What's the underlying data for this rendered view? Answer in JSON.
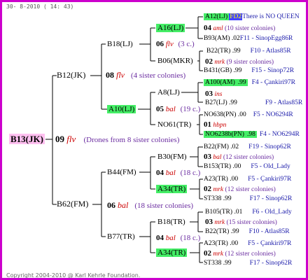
{
  "header": {
    "date": "30- 8-2010 ( 14: 43)"
  },
  "footer": {
    "copyright": "Copyright 2004-2010 @ Karl Kehrle Foundation."
  },
  "root": {
    "id": "B13(JK)",
    "year": "09",
    "mark": "flv",
    "note": "(Drones from 8 sister colonies)"
  },
  "gen1": {
    "upper": {
      "id": "B12(JK)"
    },
    "lower": {
      "id": "B62(FM)"
    }
  },
  "gen2": {
    "b18": {
      "id": "B18(LJ)"
    },
    "a10": {
      "id": "A10(LJ)"
    },
    "b44": {
      "id": "B44(FM)"
    },
    "b77": {
      "id": "B77(TR)"
    },
    "mid_upper": {
      "year": "08",
      "mark": "flv",
      "note": "(4 sister colonies)"
    },
    "mid_lower": {
      "year": "06",
      "mark": "bal",
      "note": "(18 sister colonies)"
    }
  },
  "gen3": {
    "a16": {
      "id": "A16(LJ)"
    },
    "b06": {
      "id": "B06(MKR)"
    },
    "a8": {
      "id": "A8(LJ)"
    },
    "no61": {
      "id": "NO61(TR)"
    },
    "b30": {
      "id": "B30(FM)"
    },
    "a34a": {
      "id": "A34(TR)"
    },
    "b18tr": {
      "id": "B18(TR)"
    },
    "a34b": {
      "id": "A34(TR)"
    },
    "m1": {
      "year": "06",
      "mark": "flv",
      "note": "(3 c.)"
    },
    "m2": {
      "year": "05",
      "mark": "bal",
      "note": "(19 c.)"
    },
    "m3": {
      "year": "04",
      "mark": "bal",
      "note": "(18 c.)"
    },
    "m4": {
      "year": "04",
      "mark": "bal",
      "note": "(18 c.)"
    }
  },
  "gen4": [
    {
      "id": "A12(LJ)",
      "extra": "FD2",
      "note": "There is NO QUEEN"
    },
    {
      "year": "04",
      "mark": "aml",
      "note": "(10 sister colonies)"
    },
    {
      "id": "B93(AM)",
      "num": ".02",
      "pos": "F11 - SinopEgg86R"
    },
    {
      "id": "B22(TR)",
      "num": ".99",
      "pos": "F10 - Atlas85R"
    },
    {
      "year": "02",
      "mark": "mrk",
      "note": "(9 sister colonies)"
    },
    {
      "id": "B431(GB)",
      "num": ".99",
      "pos": "F15 - Sinop72R"
    },
    {
      "id": "A100(AM)",
      "num": ".99",
      "pos": "F4 - Çankiri97R"
    },
    {
      "year": "03",
      "mark": "ins",
      "note": ""
    },
    {
      "id": "B27(LJ)",
      "num": ".99",
      "pos": "F9 - Atlas85R"
    },
    {
      "id": "NO638(PN)",
      "num": ".00",
      "pos": "F5 - NO6294R"
    },
    {
      "year": "01",
      "mark": "hbpn",
      "note": ""
    },
    {
      "id": "NO6238b(PN)",
      "num": ".98",
      "pos": "F4 - NO6294R"
    },
    {
      "id": "B22(FM)",
      "num": ".02",
      "pos": "F19 - Sinop62R"
    },
    {
      "year": "03",
      "mark": "bal",
      "note": "(12 sister colonies)"
    },
    {
      "id": "B153(TR)",
      "num": ".00",
      "pos": "F5 - Old_Lady"
    },
    {
      "id": "A23(TR)",
      "num": ".00",
      "pos": "F5 - Çankiri97R"
    },
    {
      "year": "02",
      "mark": "mrk",
      "note": "(12 sister colonies)"
    },
    {
      "id": "ST338",
      "num": ".99",
      "pos": "F17 - Sinop62R"
    },
    {
      "id": "B105(TR)",
      "num": ".01",
      "pos": "F6 - Old_Lady"
    },
    {
      "year": "03",
      "mark": "mrk",
      "note": "(15 sister colonies)"
    },
    {
      "id": "B22(TR)",
      "num": ".99",
      "pos": "F10 - Atlas85R"
    },
    {
      "id": "A23(TR)",
      "num": ".00",
      "pos": "F5 - Çankiri97R"
    },
    {
      "year": "02",
      "mark": "mrk",
      "note": "(12 sister colonies)"
    },
    {
      "id": "ST338",
      "num": ".99",
      "pos": "F17 - Sinop62R"
    }
  ]
}
